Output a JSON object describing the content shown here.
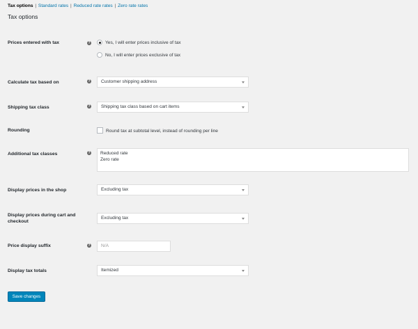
{
  "subnav": {
    "items": [
      {
        "label": "Tax options",
        "current": true
      },
      {
        "label": "Standard rates",
        "current": false
      },
      {
        "label": "Reduced rate rates",
        "current": false
      },
      {
        "label": "Zero rate rates",
        "current": false
      }
    ],
    "separator": "|"
  },
  "heading": "Tax options",
  "help_glyph": "?",
  "fields": {
    "prices_entered": {
      "label": "Prices entered with tax",
      "options": [
        {
          "label": "Yes, I will enter prices inclusive of tax",
          "checked": true
        },
        {
          "label": "No, I will enter prices exclusive of tax",
          "checked": false
        }
      ]
    },
    "calculate_based_on": {
      "label": "Calculate tax based on",
      "value": "Customer shipping address"
    },
    "shipping_tax_class": {
      "label": "Shipping tax class",
      "value": "Shipping tax class based on cart items"
    },
    "rounding": {
      "label": "Rounding",
      "checkbox_label": "Round tax at subtotal level, instead of rounding per line",
      "checked": false
    },
    "additional_classes": {
      "label": "Additional tax classes",
      "lines": [
        "Reduced rate",
        "Zero rate"
      ]
    },
    "display_shop": {
      "label": "Display prices in the shop",
      "value": "Excluding tax"
    },
    "display_cart": {
      "label": "Display prices during cart and checkout",
      "value": "Excluding tax"
    },
    "price_suffix": {
      "label": "Price display suffix",
      "placeholder": "N/A"
    },
    "display_totals": {
      "label": "Display tax totals",
      "value": "Itemized"
    }
  },
  "save_button": "Save changes",
  "colors": {
    "accent": "#0085ba",
    "link": "#0073aa",
    "background": "#f1f1f1"
  }
}
